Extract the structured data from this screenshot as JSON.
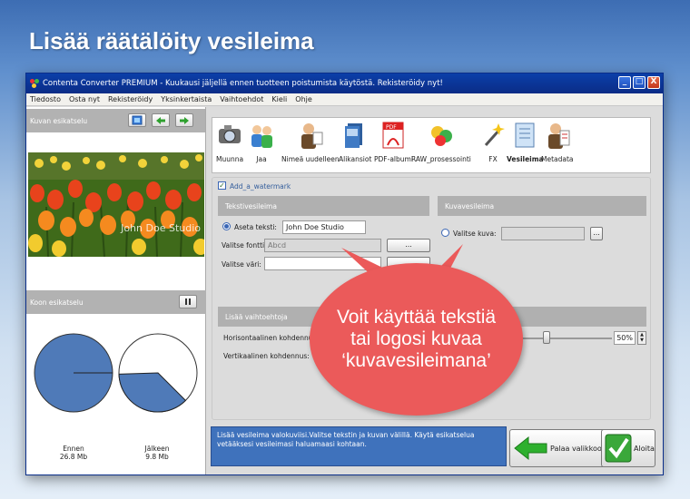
{
  "headline": "Lisää räätälöity vesileima",
  "window": {
    "title": "Contenta Converter PREMIUM  - Kuukausi jäljellä ennen tuotteen poistumista käytöstä. Rekisteröidy nyt!",
    "controls": [
      "_",
      "□",
      "X"
    ]
  },
  "menu": [
    "Tiedosto",
    "Osta nyt",
    "Rekisteröidy",
    "Yksinkertaista",
    "Vaihtoehdot",
    "Kieli",
    "Ohje"
  ],
  "preview": {
    "title": "Kuvan esikatselu",
    "watermark": "John Doe Studio"
  },
  "size_preview": {
    "title": "Koon esikatselu",
    "before_label": "Ennen",
    "before_size": "26.8 Mb",
    "after_label": "Jälkeen",
    "after_size": "9.8 Mb",
    "after_fraction": 0.37
  },
  "toolbar": {
    "items": [
      "Muunna",
      "Jaa",
      "Nimeä uudelleen",
      "Alikansiot",
      "PDF-albumi",
      "RAW_prosessointi",
      "FX",
      "Vesileima",
      "Metadata"
    ],
    "active": "Vesileima"
  },
  "watermark": {
    "enable_label": "Add_a_watermark",
    "text_section": "Tekstivesileima",
    "set_text_label": "Aseta teksti:",
    "set_text_value": "John Doe Studio",
    "font_label": "Valitse fontti:",
    "font_value": "Abcd",
    "color_label": "Valitse väri:",
    "browse": "...",
    "image_section": "Kuvavesileima",
    "image_label": "Valitse kuva:",
    "more_section": "Lisää vaihtoehtoja",
    "h_align_label": "Horisontaalinen kohdennus:",
    "v_align_label": "Vertikaalinen kohdennus:",
    "h_percent": "50%"
  },
  "callout": "Voit käyttää tekstiä tai logosi kuvaa ‘kuvavesileimana’",
  "info": "Lisää vesileima valokuviisi.Valitse tekstin ja kuvan välillä. Käytä esikatselua vetääksesi vesileimasi haluamaasi kohtaan.",
  "buttons": {
    "back": "Palaa valikkoon",
    "start": "Aloita"
  }
}
